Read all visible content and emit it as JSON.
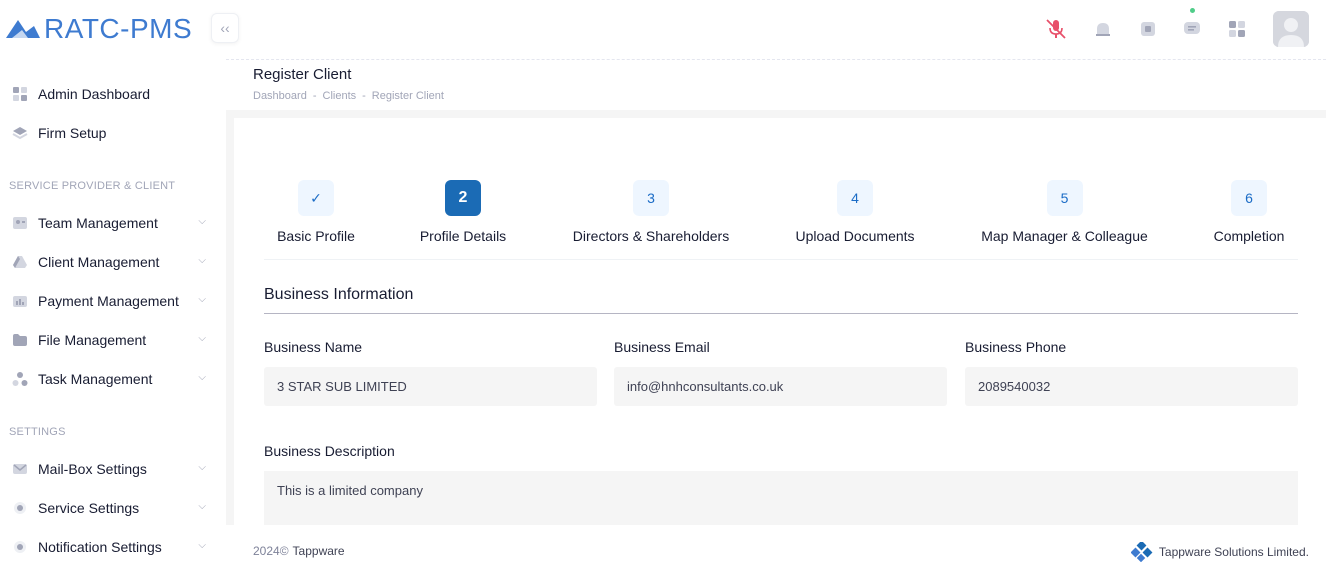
{
  "app": {
    "title": "RATC-PMS"
  },
  "sidebar": {
    "top_items": [
      {
        "label": "Admin Dashboard",
        "icon": "grid-icon"
      },
      {
        "label": "Firm Setup",
        "icon": "layers-icon"
      }
    ],
    "section1_title": "SERVICE PROVIDER & CLIENT",
    "section1_items": [
      {
        "label": "Team Management",
        "icon": "team-icon"
      },
      {
        "label": "Client Management",
        "icon": "drive-icon"
      },
      {
        "label": "Payment Management",
        "icon": "payment-icon"
      },
      {
        "label": "File Management",
        "icon": "folder-icon"
      },
      {
        "label": "Task Management",
        "icon": "task-icon"
      }
    ],
    "section2_title": "SETTINGS",
    "section2_items": [
      {
        "label": "Mail-Box Settings",
        "icon": "mail-icon"
      },
      {
        "label": "Service Settings",
        "icon": "gear-icon"
      },
      {
        "label": "Notification Settings",
        "icon": "bell-icon"
      }
    ]
  },
  "header": {
    "page_title": "Register Client",
    "breadcrumb": [
      "Dashboard",
      "Clients",
      "Register Client"
    ],
    "breadcrumb_sep": "-"
  },
  "stepper": {
    "steps": [
      {
        "number": "✓",
        "label": "Basic Profile",
        "state": "done"
      },
      {
        "number": "2",
        "label": "Profile Details",
        "state": "active"
      },
      {
        "number": "3",
        "label": "Directors & Shareholders",
        "state": "pending"
      },
      {
        "number": "4",
        "label": "Upload Documents",
        "state": "pending"
      },
      {
        "number": "5",
        "label": "Map Manager & Colleague",
        "state": "pending"
      },
      {
        "number": "6",
        "label": "Completion",
        "state": "pending"
      }
    ]
  },
  "form": {
    "section_title": "Business Information",
    "business_name_label": "Business Name",
    "business_name_value": "3 STAR SUB LIMITED",
    "business_email_label": "Business Email",
    "business_email_value": "info@hnhconsultants.co.uk",
    "business_phone_label": "Business Phone",
    "business_phone_value": "2089540032",
    "business_description_label": "Business Description",
    "business_description_value": "This is a limited company"
  },
  "footer": {
    "year": "2024©",
    "brand": "Tappware",
    "company": "Tappware Solutions Limited."
  },
  "colors": {
    "primary": "#1b6bb5",
    "logo": "#3e7bd0",
    "mic_muted": "#e8506a",
    "online_dot": "#50cd89"
  }
}
